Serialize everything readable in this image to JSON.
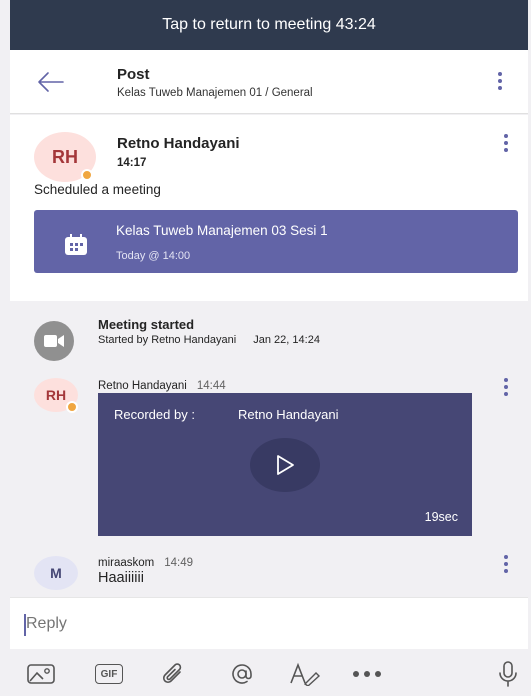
{
  "banner": {
    "text": "Tap to return to meeting 43:24"
  },
  "header": {
    "title": "Post",
    "subtitle": "Kelas Tuweb Manajemen 01 / General"
  },
  "post": {
    "avatar_initials": "RH",
    "author": "Retno Handayani",
    "time": "14:17",
    "action": "Scheduled a meeting",
    "meeting": {
      "title": "Kelas Tuweb Manajemen 03 Sesi 1",
      "time": "Today @ 14:00"
    }
  },
  "thread": {
    "meeting_started": {
      "title": "Meeting started",
      "subtitle": "Started by Retno Handayani",
      "date": "Jan 22, 14:24"
    },
    "recording_message": {
      "avatar_initials": "RH",
      "author": "Retno Handayani",
      "time": "14:44",
      "recorded_by_label": "Recorded by :",
      "recorded_by_name": "Retno Handayani",
      "duration": "19sec"
    },
    "chat_message": {
      "avatar_initials": "M",
      "author": "miraaskom",
      "time": "14:49",
      "text": "Haaiiiiii"
    }
  },
  "reply": {
    "placeholder": "Reply"
  },
  "toolbar": {
    "gif_label": "GIF"
  },
  "colors": {
    "accent": "#6264a7",
    "banner": "#2f3a4e",
    "recording_bg": "#464775",
    "avatar_rh_bg": "#fde0dd",
    "avatar_rh_text": "#a4373a",
    "avatar_m_bg": "#e3e4f4",
    "avatar_m_text": "#464775",
    "status_away": "#f0a640"
  }
}
